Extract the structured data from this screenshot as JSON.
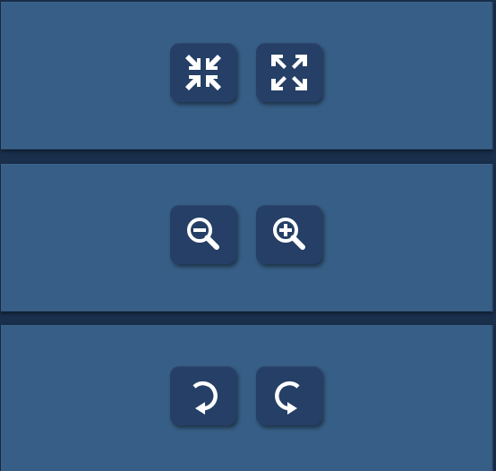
{
  "panels": [
    {
      "name": "fullscreen-controls",
      "buttons": [
        {
          "icon": "exit-fullscreen-icon",
          "action": "exit-fullscreen"
        },
        {
          "icon": "enter-fullscreen-icon",
          "action": "enter-fullscreen"
        }
      ]
    },
    {
      "name": "zoom-controls",
      "buttons": [
        {
          "icon": "zoom-out-icon",
          "action": "zoom-out"
        },
        {
          "icon": "zoom-in-icon",
          "action": "zoom-in"
        }
      ]
    },
    {
      "name": "rotate-controls",
      "buttons": [
        {
          "icon": "rotate-left-icon",
          "action": "rotate-left"
        },
        {
          "icon": "rotate-right-icon",
          "action": "rotate-right"
        }
      ]
    }
  ],
  "colors": {
    "background": "#1a2f4c",
    "panel": "#375e86",
    "button": "#253f66",
    "icon": "#ffffff"
  }
}
